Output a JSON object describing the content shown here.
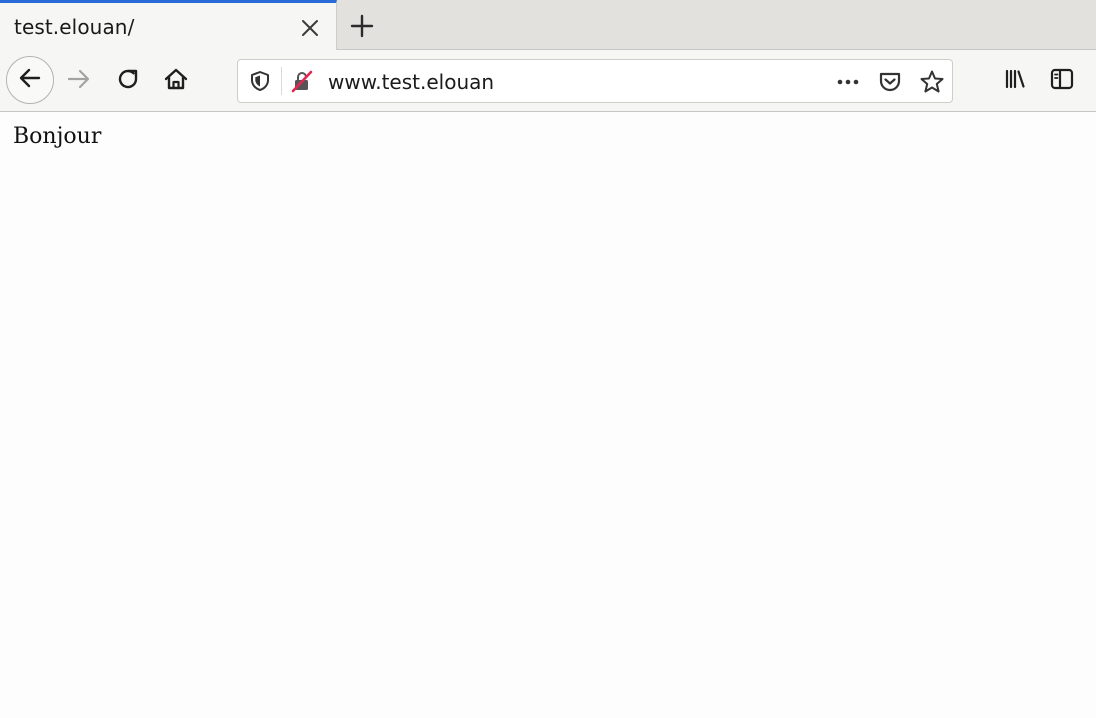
{
  "tab": {
    "title": "test.elouan/"
  },
  "toolbar": {
    "url": "www.test.elouan"
  },
  "page": {
    "body_text": "Bonjour"
  },
  "icons": {
    "back": "arrow-left-icon",
    "forward": "arrow-right-icon",
    "reload": "reload-icon",
    "home": "home-icon",
    "tracking_protection": "shield-icon",
    "insecure_connection": "lock-strikethrough-icon",
    "page_actions": "more-icon",
    "pocket": "pocket-icon",
    "bookmark": "star-icon",
    "library": "library-icon",
    "sidebar": "sidebar-icon",
    "close_tab": "close-icon",
    "new_tab": "plus-icon"
  },
  "colors": {
    "active_tab_accent": "#2a6ad9",
    "insecure_icon": "#e22850"
  }
}
